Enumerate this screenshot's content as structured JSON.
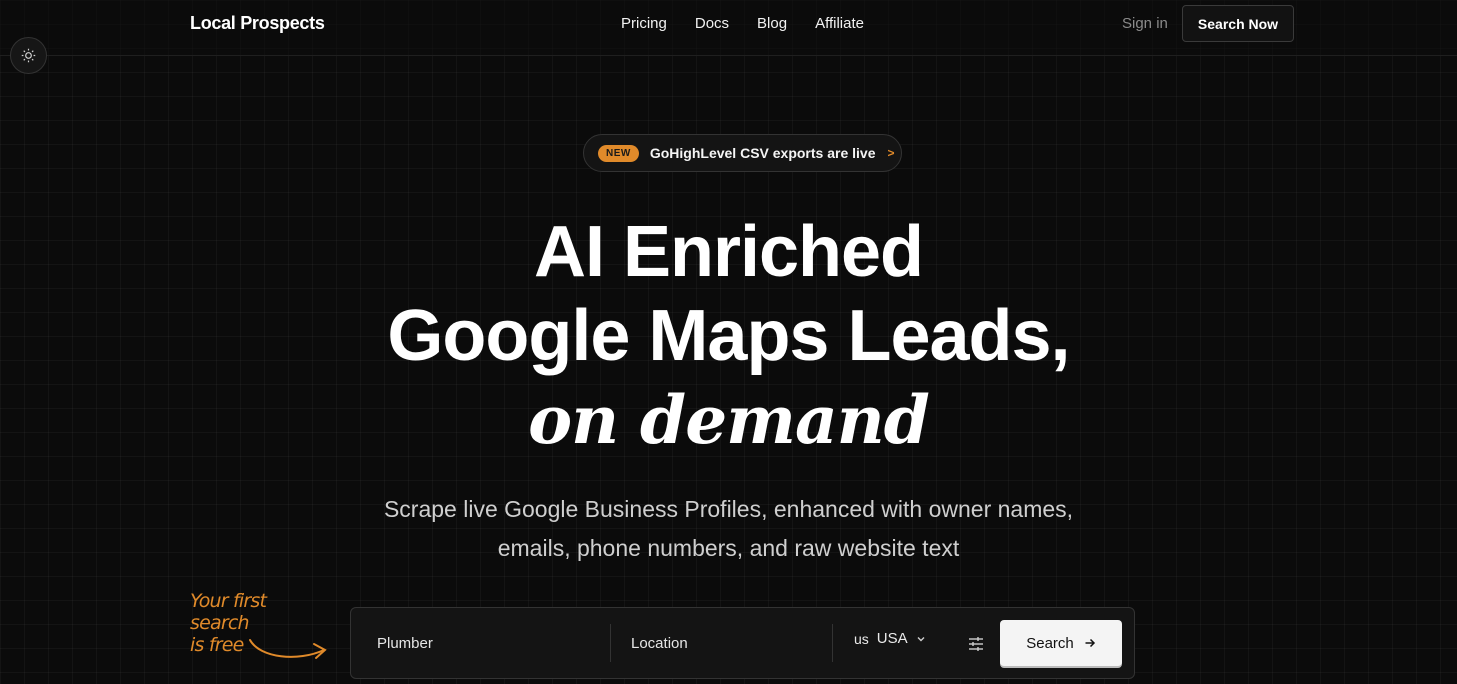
{
  "nav": {
    "brand": "Local Prospects",
    "links": [
      "Pricing",
      "Docs",
      "Blog",
      "Affiliate"
    ],
    "signin": "Sign in",
    "cta": "Search Now"
  },
  "announcement": {
    "badge": "NEW",
    "text": "GoHighLevel CSV exports are live",
    "arrow": ">"
  },
  "hero": {
    "line1": "AI Enriched",
    "line2": "Google Maps Leads,",
    "line3": "on demand",
    "subtitle_line1": "Scrape live Google Business Profiles, enhanced with owner names,",
    "subtitle_line2": "emails, phone numbers, and raw website text"
  },
  "note": {
    "line1": "Your first search",
    "line2": "is free"
  },
  "search": {
    "keyword_value": "Plumber",
    "location_placeholder": "Location",
    "country_code": "us",
    "country": "USA",
    "button": "Search"
  },
  "colors": {
    "accent": "#e08a2a",
    "background": "#0b0b0b"
  },
  "icons": [
    "sun-icon",
    "chevron-down-icon",
    "sliders-icon",
    "arrow-right-icon",
    "curved-arrow-icon"
  ]
}
